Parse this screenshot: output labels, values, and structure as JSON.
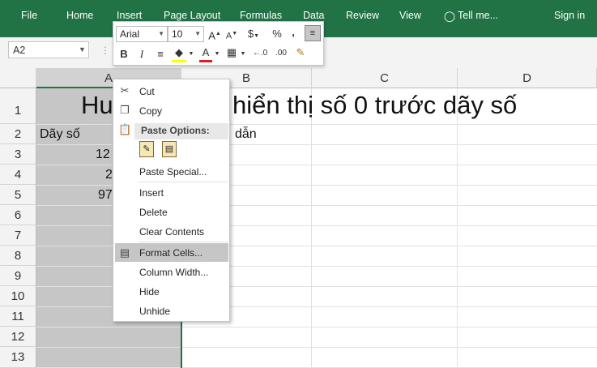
{
  "ribbon": {
    "tabs": [
      "File",
      "Home",
      "Insert",
      "Page Layout",
      "Formulas",
      "Data",
      "Review",
      "View"
    ],
    "tell_me": "Tell me...",
    "sign_in": "Sign in"
  },
  "formula_bar": {
    "name_box": "A2"
  },
  "mini_toolbar": {
    "font_name": "Arial",
    "font_size": "10",
    "buttons": [
      "grow-font",
      "shrink-font",
      "currency",
      "percent",
      "comma",
      "wrap",
      "bold",
      "italic",
      "align",
      "fill-color",
      "font-color",
      "borders",
      "increase-decimal",
      "decrease-decimal",
      "format-painter"
    ]
  },
  "columns": [
    "A",
    "B",
    "C",
    "D"
  ],
  "rows": [
    "1",
    "2",
    "3",
    "4",
    "5",
    "6",
    "7",
    "8",
    "9",
    "10",
    "11",
    "12",
    "13"
  ],
  "cells": {
    "title_left": "Hu",
    "title_right": "hiển thị số 0 trước dãy số",
    "a2": "Dãy số",
    "b2": "dẫn",
    "a3": "12",
    "a4": "2",
    "a5": "97"
  },
  "context_menu": {
    "cut": "Cut",
    "copy": "Copy",
    "paste_options": "Paste Options:",
    "paste_special": "Paste Special...",
    "insert": "Insert",
    "delete": "Delete",
    "clear_contents": "Clear Contents",
    "format_cells": "Format Cells...",
    "column_width": "Column Width...",
    "hide": "Hide",
    "unhide": "Unhide"
  },
  "colors": {
    "accent": "#217346",
    "selection": "#c6c6c6"
  }
}
